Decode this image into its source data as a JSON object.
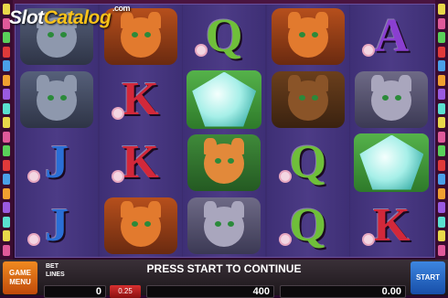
{
  "logo": {
    "slot": "Slot",
    "catalog": "Catalog",
    "domain": ".com"
  },
  "grid": [
    [
      "wolf",
      "wolf",
      "J",
      "J"
    ],
    [
      "fox",
      "K",
      "K",
      "fox"
    ],
    [
      "Q",
      "diamond",
      "cat",
      "mouse"
    ],
    [
      "fox",
      "bear",
      "Q",
      "Q"
    ],
    [
      "A",
      "mouse",
      "diamond",
      "K"
    ]
  ],
  "panel": {
    "game_menu_label_1": "GAME",
    "game_menu_label_2": "MENU",
    "bet_label": "BET",
    "lines_label": "LINES",
    "message": "PRESS START TO CONTINUE",
    "bet_value": "0",
    "bet_button": "0.25",
    "lines_value": "400",
    "win_value": "0.00",
    "start_label": "START"
  },
  "colors": {
    "menu": "#f08a20",
    "start": "#3d86e0"
  }
}
